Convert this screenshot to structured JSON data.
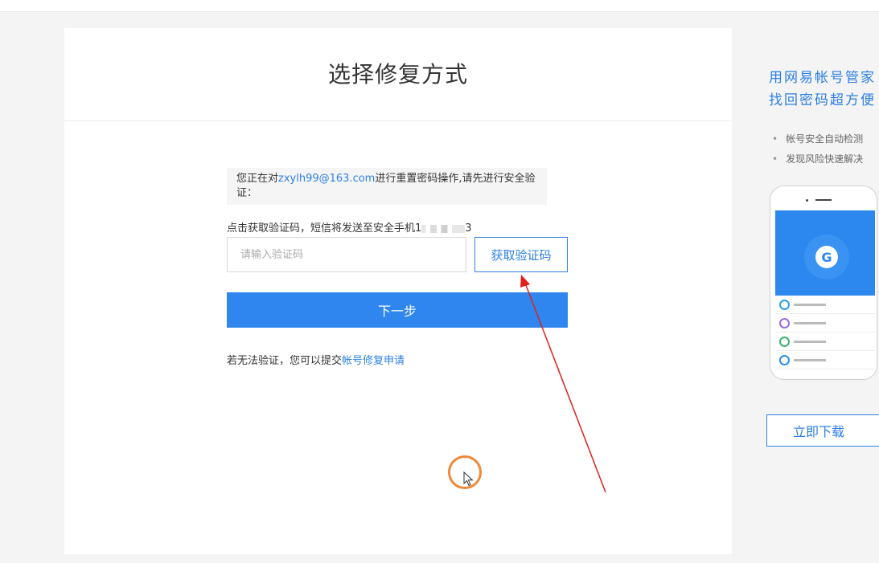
{
  "header": {
    "title": "选择修复方式"
  },
  "notice": {
    "prefix": "您正在对",
    "email": "zxylh99@163.com",
    "suffix": "进行重置密码操作,请先进行安全验证："
  },
  "sms": {
    "text": "点击获取验证码，短信将发送至安全手机1",
    "masked_suffix": "3"
  },
  "form": {
    "code_placeholder": "请输入验证码",
    "get_code_label": "获取验证码",
    "next_label": "下一步"
  },
  "fallback": {
    "text": "若无法验证，您可以提交",
    "link": "帐号修复申请"
  },
  "side": {
    "promo_line1": "用网易帐号管家",
    "promo_line2": "找回密码超方便",
    "bullets": [
      "帐号安全自动检测",
      "发现风险快速解决"
    ],
    "download_label": "立即下载"
  },
  "colors": {
    "accent": "#2c7fe3",
    "primary_button": "#2e86ee",
    "arrow": "#e0201c",
    "cursor_ring": "#f0883a"
  },
  "icons": {
    "app_logo": "shield-g-icon",
    "cursor": "mouse-pointer-icon"
  }
}
